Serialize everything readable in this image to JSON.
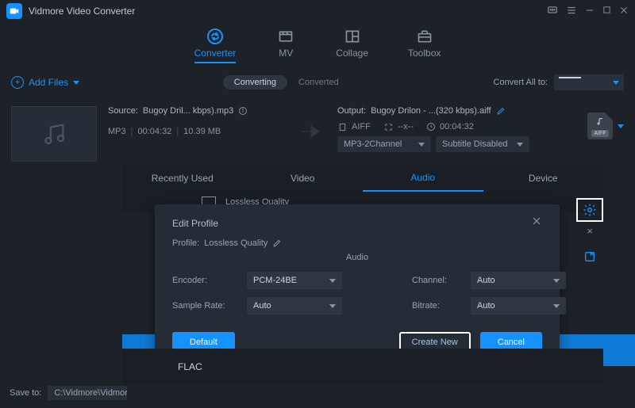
{
  "app": {
    "title": "Vidmore Video Converter"
  },
  "nav": {
    "converter": "Converter",
    "mv": "MV",
    "collage": "Collage",
    "toolbox": "Toolbox"
  },
  "toolbar": {
    "add_files": "Add Files",
    "converting": "Converting",
    "converted": "Converted",
    "convert_all_to": "Convert All to:"
  },
  "file": {
    "source_prefix": "Source:",
    "source_name": "Bugoy Dril... kbps).mp3",
    "format_badge": "MP3",
    "duration": "00:04:32",
    "size": "10.39 MB",
    "output_prefix": "Output:",
    "output_name": "Bugoy Drilon - ...(320 kbps).aiff",
    "out_fmt": "AIFF",
    "out_dim": "--x--",
    "out_dur": "00:04:32",
    "audio_sel": "MP3-2Channel",
    "sub_sel": "Subtitle Disabled",
    "out_badge": "AIFF"
  },
  "fmt_panel": {
    "tab_recent": "Recently Used",
    "tab_video": "Video",
    "tab_audio": "Audio",
    "tab_device": "Device",
    "quality_label": "Lossless Quality"
  },
  "dialog": {
    "title": "Edit Profile",
    "profile_prefix": "Profile:",
    "profile_value": "Lossless Quality",
    "section": "Audio",
    "encoder_label": "Encoder:",
    "encoder_value": "PCM-24BE",
    "samplerate_label": "Sample Rate:",
    "samplerate_value": "Auto",
    "channel_label": "Channel:",
    "channel_value": "Auto",
    "bitrate_label": "Bitrate:",
    "bitrate_value": "Auto",
    "btn_default": "Default",
    "btn_create": "Create New",
    "btn_cancel": "Cancel"
  },
  "bottom": {
    "flac": "FLAC",
    "saveto_label": "Save to:",
    "saveto_path": "C:\\Vidmore\\Vidmor"
  },
  "colors": {
    "accent": "#1592ff"
  }
}
